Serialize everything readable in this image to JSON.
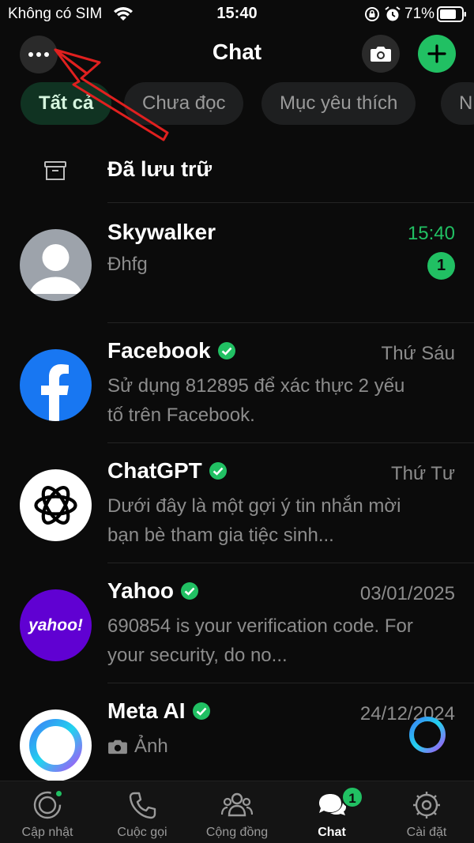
{
  "status_bar": {
    "carrier": "Không có SIM",
    "time": "15:40",
    "battery": "71%"
  },
  "header": {
    "title": "Chat",
    "more_icon": "ellipsis-icon",
    "camera_icon": "camera-icon",
    "new_chat_icon": "plus-icon"
  },
  "filters": [
    {
      "label": "Tất cả",
      "active": true
    },
    {
      "label": "Chưa đọc",
      "active": false
    },
    {
      "label": "Mục yêu thích",
      "active": false
    },
    {
      "label": "N",
      "active": false
    }
  ],
  "archived": {
    "label": "Đã lưu trữ"
  },
  "chats": [
    {
      "name": "Skywalker",
      "time": "15:40",
      "preview": "Đhfg",
      "unread": "1",
      "verified": false
    },
    {
      "name": "Facebook",
      "time": "Thứ Sáu",
      "preview": "Sử dụng 812895 để xác thực 2 yếu tố trên Facebook.",
      "verified": true
    },
    {
      "name": "ChatGPT",
      "time": "Thứ Tư",
      "preview": "Dưới đây là một gợi ý tin nhắn mời bạn bè tham gia tiệc sinh...",
      "verified": true
    },
    {
      "name": "Yahoo",
      "time": "03/01/2025",
      "preview": "690854 is your verification code. For your security, do no...",
      "verified": true
    },
    {
      "name": "Meta AI",
      "time": "24/12/2024",
      "preview": "Ảnh",
      "verified": true
    }
  ],
  "avatar_texts": {
    "yahoo": "yahoo!"
  },
  "bottom_nav": [
    {
      "label": "Cập nhật",
      "icon": "status-icon"
    },
    {
      "label": "Cuộc gọi",
      "icon": "phone-icon"
    },
    {
      "label": "Cộng đồng",
      "icon": "community-icon"
    },
    {
      "label": "Chat",
      "icon": "chat-icon",
      "badge": "1",
      "active": true
    },
    {
      "label": "Cài đặt",
      "icon": "settings-icon"
    }
  ],
  "colors": {
    "accent": "#21c063",
    "background": "#0b0b0b",
    "annotation": "#e0201f"
  }
}
